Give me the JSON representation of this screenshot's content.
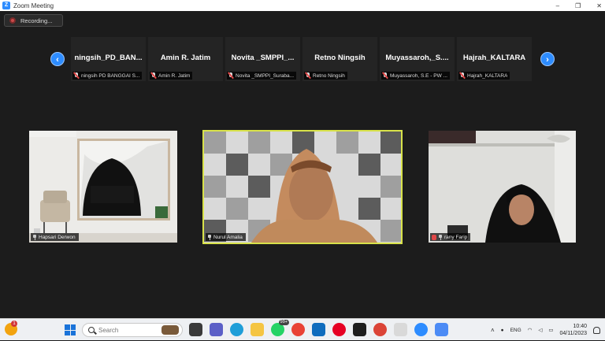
{
  "window": {
    "title": "Zoom Meeting",
    "controls": [
      "–",
      "❐",
      "✕"
    ]
  },
  "recording": {
    "label": "Recording..."
  },
  "strip": {
    "tiles": [
      {
        "name": "ningsih_PD_BAN...",
        "label": "ningsih PD BANGGAI S..."
      },
      {
        "name": "Amin R. Jatim",
        "label": "Amin R. Jatim"
      },
      {
        "name": "Novita _SMPPI_...",
        "label": "Novita _SMPPI_Suraba..."
      },
      {
        "name": "Retno Ningsih",
        "label": "Retno Ningsih"
      },
      {
        "name": "Muyassaroh,_S....",
        "label": "Muyassaroh, S.E - PW ..."
      },
      {
        "name": "Hajrah_KALTARA",
        "label": "Hajrah_KALTARA"
      }
    ],
    "prev_icon": "chevron-left-icon",
    "next_icon": "chevron-right-icon"
  },
  "videos": [
    {
      "label": "Hapsari Derwon"
    },
    {
      "label": "Nurul Amalia"
    },
    {
      "label": "rany Farip"
    }
  ],
  "taskbar": {
    "weather_badge": "1",
    "search_placeholder": "Search",
    "app_badge": "99+",
    "lang": "ENG",
    "time": "10:40",
    "date": "04/11/2023",
    "colors": {
      "windows_accent": "#1a73d9",
      "zoom_blue": "#2d8cff",
      "speaker_border": "#d8e24a",
      "mic_muted": "#e04848"
    }
  }
}
